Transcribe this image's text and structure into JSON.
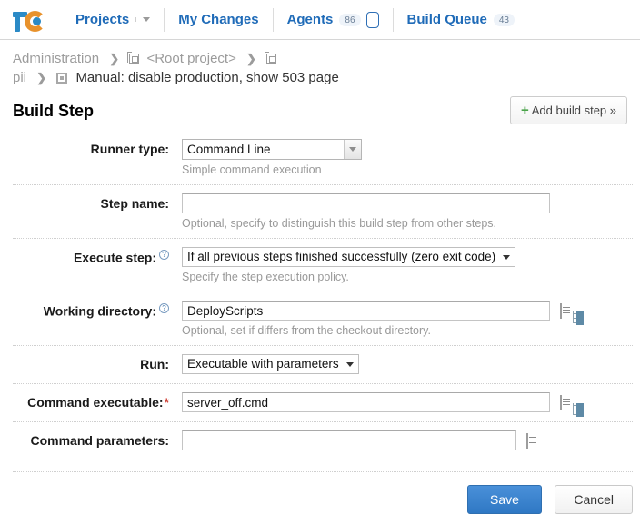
{
  "nav": {
    "logo_name": "teamcity-logo",
    "items": [
      {
        "label": "Projects",
        "badge": null,
        "has_caret": true
      },
      {
        "label": "My Changes",
        "badge": null,
        "has_caret": false
      },
      {
        "label": "Agents",
        "badge": "86",
        "has_caret": false
      },
      {
        "label": "Build Queue",
        "badge": "43",
        "has_caret": false
      }
    ]
  },
  "breadcrumb": {
    "line1": {
      "administration": "Administration",
      "separator": "❯",
      "root_project": "<Root project>"
    },
    "line2": {
      "project": "pii",
      "separator": "❯",
      "build_config": "Manual: disable production, show 503 page"
    }
  },
  "page": {
    "title": "Build Step",
    "add_build_step": "Add build step »",
    "plus": "+"
  },
  "form": {
    "runner_type": {
      "label": "Runner type:",
      "value": "Command Line",
      "hint": "Simple command execution"
    },
    "step_name": {
      "label": "Step name:",
      "value": "",
      "hint": "Optional, specify to distinguish this build step from other steps."
    },
    "execute_step": {
      "label": "Execute step:",
      "help": "?",
      "value": "If all previous steps finished successfully (zero exit code)",
      "hint": "Specify the step execution policy."
    },
    "working_directory": {
      "label": "Working directory:",
      "help": "?",
      "value": "DeployScripts",
      "hint": "Optional, set if differs from the checkout directory."
    },
    "run": {
      "label": "Run:",
      "value": "Executable with parameters"
    },
    "command_executable": {
      "label": "Command executable:",
      "required": "*",
      "value": "server_off.cmd"
    },
    "command_parameters": {
      "label": "Command parameters:",
      "value": ""
    }
  },
  "footer": {
    "save": "Save",
    "cancel": "Cancel"
  },
  "colors": {
    "link_blue": "#1f6bb8",
    "save_blue": "#2f78c4",
    "logo_orange": "#e8922c",
    "logo_blue": "#2b8ac6",
    "required_red": "#d0453a",
    "plus_green": "#4aa34a"
  }
}
